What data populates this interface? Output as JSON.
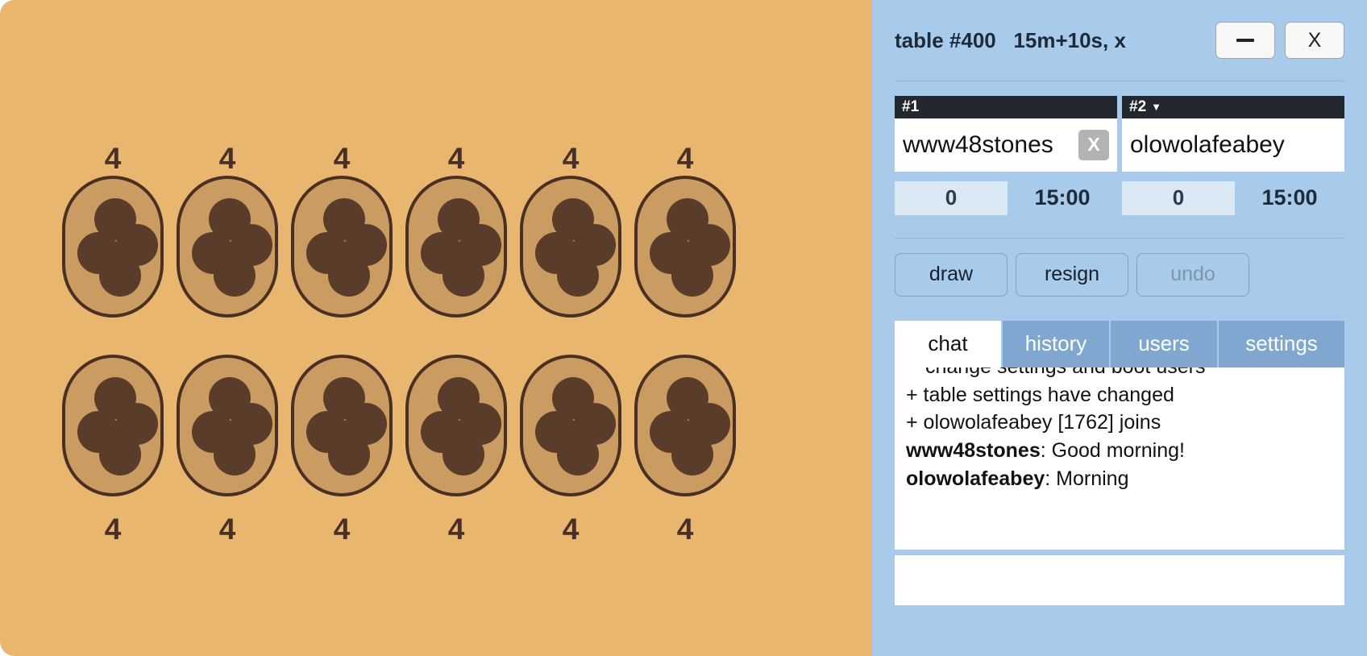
{
  "window": {
    "title": "table #400   15m+10s, x",
    "minimize_label": "–",
    "close_label": "X"
  },
  "players": [
    {
      "seat": "#1",
      "seat_caret": "",
      "name": "www48stones",
      "kick_label": "X",
      "score": "0",
      "clock": "15:00"
    },
    {
      "seat": "#2",
      "seat_caret": "▼",
      "name": "olowolafeabey",
      "kick_label": "",
      "score": "0",
      "clock": "15:00"
    }
  ],
  "actions": [
    {
      "label": "draw",
      "disabled": false
    },
    {
      "label": "resign",
      "disabled": false
    },
    {
      "label": "undo",
      "disabled": true
    }
  ],
  "tabs": [
    {
      "label": "chat",
      "active": true
    },
    {
      "label": "history",
      "active": false
    },
    {
      "label": "users",
      "active": false
    },
    {
      "label": "settings",
      "active": false
    }
  ],
  "chat": {
    "lines": [
      {
        "type": "system-cont",
        "text": "change settings and boot users"
      },
      {
        "type": "system",
        "text": "+ table settings have changed"
      },
      {
        "type": "system",
        "text": "+ olowolafeabey [1762] joins"
      },
      {
        "type": "message",
        "author": "www48stones",
        "text": ": Good morning!"
      },
      {
        "type": "message",
        "author": "olowolafeabey",
        "text": ": Morning"
      }
    ],
    "input_value": "",
    "input_placeholder": ""
  },
  "board": {
    "top_counts": [
      "4",
      "4",
      "4",
      "4",
      "4",
      "4"
    ],
    "bottom_counts": [
      "4",
      "4",
      "4",
      "4",
      "4",
      "4"
    ],
    "top_seeds": [
      4,
      4,
      4,
      4,
      4,
      4
    ],
    "bottom_seeds": [
      4,
      4,
      4,
      4,
      4,
      4
    ]
  },
  "colors": {
    "board_bg": "#e8b66e",
    "pit_fill": "#cb9c62",
    "pit_stroke": "#4a3022",
    "seed": "#5a3c2a",
    "panel_bg": "#a8cbeb",
    "tab_inactive": "#7fa7cf",
    "seat_header": "#23272e",
    "score_box": "#dbe9f5"
  }
}
